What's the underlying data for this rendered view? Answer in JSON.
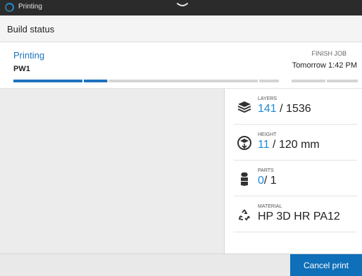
{
  "topbar": {
    "app_label": "Printing"
  },
  "header": {
    "title": "Build status"
  },
  "job": {
    "status": "Printing",
    "name": "PW1",
    "finish_label": "FINISH JOB",
    "finish_time": "Tomorrow 1:42 PM",
    "progress_segments": [
      {
        "fill_fraction": 1.0
      },
      {
        "fill_fraction": 0.95
      },
      {
        "fill_fraction": 0.0
      },
      {
        "fill_fraction": 0.0
      },
      {
        "fill_fraction": 0.0
      },
      {
        "fill_fraction": 0.0
      }
    ]
  },
  "metrics": {
    "layers": {
      "label": "LAYERS",
      "current": "141",
      "total": " / 1536",
      "icon": "layers-icon"
    },
    "height": {
      "label": "HEIGHT",
      "current": "11",
      "total": " / 120 mm",
      "icon": "height-icon"
    },
    "parts": {
      "label": "PARTS",
      "current": "0",
      "total": "/ 1",
      "icon": "parts-icon"
    },
    "material": {
      "label": "MATERIAL",
      "value": "HP 3D HR PA12",
      "icon": "recycle-icon"
    }
  },
  "footer": {
    "cancel_label": "Cancel print"
  },
  "colors": {
    "accent": "#1e73be",
    "button": "#0f6fb8",
    "topbar": "#2b2b2b"
  }
}
